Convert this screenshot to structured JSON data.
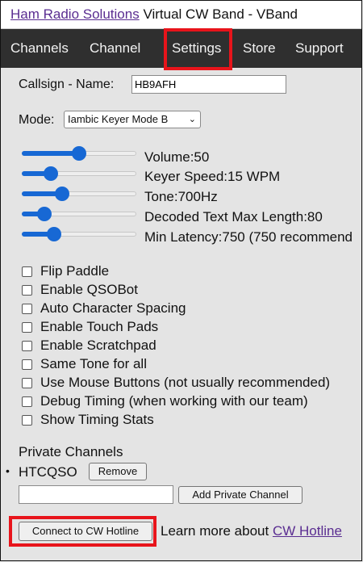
{
  "header": {
    "site_link": "Ham Radio Solutions",
    "title": "Virtual CW Band - VBand"
  },
  "nav": {
    "tabs": [
      {
        "label": "Channels"
      },
      {
        "label": "Channel"
      },
      {
        "label": "Settings"
      },
      {
        "label": "Store"
      },
      {
        "label": "Support"
      }
    ],
    "active": "Settings"
  },
  "settings": {
    "callsign_label": "Callsign - Name:",
    "callsign_value": "HB9AFH",
    "mode_label": "Mode:",
    "mode_value": "Iambic Keyer Mode B",
    "sliders": [
      {
        "label": "Volume:50",
        "value": 0.5
      },
      {
        "label": "Keyer Speed:15 WPM",
        "value": 0.25
      },
      {
        "label": "Tone:700Hz",
        "value": 0.35
      },
      {
        "label": "Decoded Text Max Length:80",
        "value": 0.2
      },
      {
        "label": "Min Latency:750 (750 recommend",
        "value": 0.28
      }
    ],
    "checkboxes": [
      {
        "label": "Flip Paddle",
        "checked": false
      },
      {
        "label": "Enable QSOBot",
        "checked": false
      },
      {
        "label": "Auto Character Spacing",
        "checked": false
      },
      {
        "label": "Enable Touch Pads",
        "checked": false
      },
      {
        "label": "Enable Scratchpad",
        "checked": false
      },
      {
        "label": "Same Tone for all",
        "checked": false
      },
      {
        "label": "Use Mouse Buttons (not usually recommended)",
        "checked": false
      },
      {
        "label": "Debug Timing (when working with our team)",
        "checked": false
      },
      {
        "label": "Show Timing Stats",
        "checked": false
      }
    ]
  },
  "private_channels": {
    "heading": "Private Channels",
    "items": [
      {
        "name": "HTCQSO",
        "remove_label": "Remove"
      }
    ],
    "new_value": "",
    "add_label": "Add Private Channel"
  },
  "hotline": {
    "button_label": "Connect to CW Hotline",
    "learn_text": "Learn more about",
    "learn_link": "CW Hotline"
  },
  "colors": {
    "accent": "#1768d4",
    "highlight": "#e8141b",
    "nav_bg": "#2f2f2f",
    "link": "#5a2d91"
  }
}
